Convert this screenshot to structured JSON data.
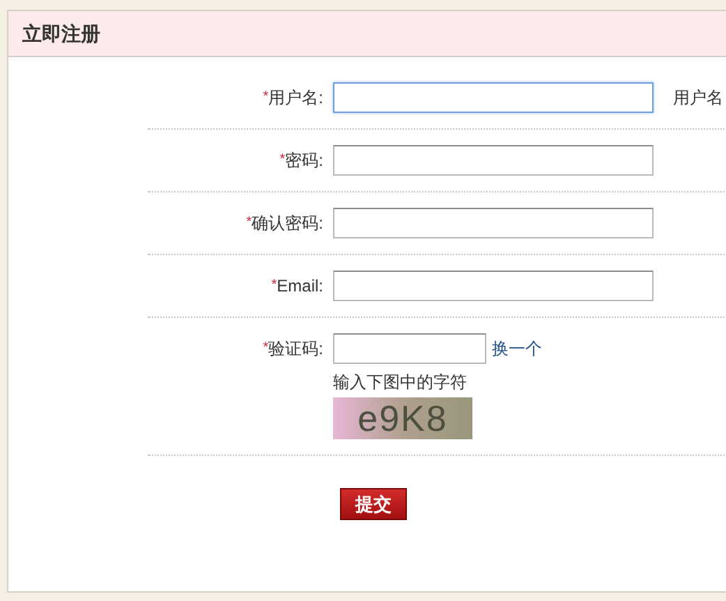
{
  "panel": {
    "title": "立即注册"
  },
  "fields": [
    {
      "kind": "text",
      "required": true,
      "label": "用户名:",
      "focused": true,
      "hint": "用户名"
    },
    {
      "kind": "text",
      "required": true,
      "label": "密码:",
      "focused": false
    },
    {
      "kind": "text",
      "required": true,
      "label": "确认密码:",
      "focused": false
    },
    {
      "kind": "text",
      "required": true,
      "label": "Email:",
      "focused": false
    },
    {
      "kind": "captcha",
      "required": true,
      "label": "验证码:",
      "focused": false,
      "refresh_link": "换一个",
      "instruction": "输入下图中的字符",
      "captcha_text": "e9K8"
    }
  ],
  "required_mark": "*",
  "submit": "提交"
}
